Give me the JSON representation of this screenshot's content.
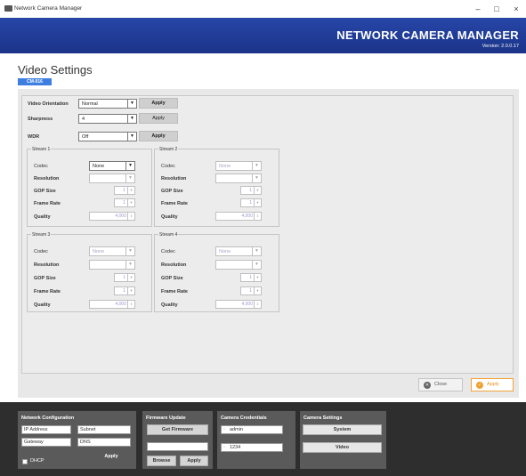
{
  "window": {
    "title": "Network Camera Manager",
    "minimize": "–",
    "maximize": "□",
    "close": "×"
  },
  "header": {
    "brand": "NETWORK CAMERA MANAGER",
    "version": "Version: 2.0.0.17",
    "color": "#1f3a93"
  },
  "page": {
    "title": "Video Settings",
    "model": "CM-916"
  },
  "settings": [
    {
      "label": "Video Orientation",
      "value": "Normal",
      "apply": "Apply"
    },
    {
      "label": "Sharpness",
      "value": "4",
      "apply": "Apply"
    },
    {
      "label": "WDR",
      "value": "Off",
      "apply": "Apply"
    }
  ],
  "streams": [
    {
      "title": "Stream 1",
      "codec_label": "Codec",
      "codec": "None",
      "resolution_label": "Resolution",
      "resolution": "",
      "gop_label": "GOP Size",
      "gop": "1",
      "fps_label": "Frame Rate",
      "fps": "1",
      "quality_label": "Quality",
      "quality": "4,000"
    },
    {
      "title": "Stream 2",
      "codec_label": "Codec",
      "codec": "None",
      "resolution_label": "Resolution",
      "resolution": "",
      "gop_label": "GOP Size",
      "gop": "1",
      "fps_label": "Frame Rate",
      "fps": "1",
      "quality_label": "Quality",
      "quality": "4,000"
    },
    {
      "title": "Stream 3",
      "codec_label": "Codec",
      "codec": "None",
      "resolution_label": "Resolution",
      "resolution": "",
      "gop_label": "GOP Size",
      "gop": "1",
      "fps_label": "Frame Rate",
      "fps": "1",
      "quality_label": "Quality",
      "quality": "4,000"
    },
    {
      "title": "Stream 4",
      "codec_label": "Codec",
      "codec": "None",
      "resolution_label": "Resolution",
      "resolution": "",
      "gop_label": "GOP Size",
      "gop": "1",
      "fps_label": "Frame Rate",
      "fps": "1",
      "quality_label": "Quality",
      "quality": "4,000"
    }
  ],
  "actions": {
    "close": "Close",
    "apply": "Apply",
    "accent": "#f0a030"
  },
  "footer": {
    "network": {
      "title": "Network Configuration",
      "ip_placeholder": "IP Address",
      "subnet_placeholder": "Subnet",
      "gateway_placeholder": "Gateway",
      "dns_placeholder": "DNS",
      "dhcp": "DHCP",
      "apply": "Apply"
    },
    "firmware": {
      "title": "Firmware Update",
      "get": "Get Firmware",
      "browse": "Browse",
      "apply": "Apply"
    },
    "credentials": {
      "title": "Camera Credentials",
      "user": "admin",
      "password": "1234"
    },
    "camera": {
      "title": "Camera Settings",
      "system": "System",
      "video": "Video"
    }
  }
}
